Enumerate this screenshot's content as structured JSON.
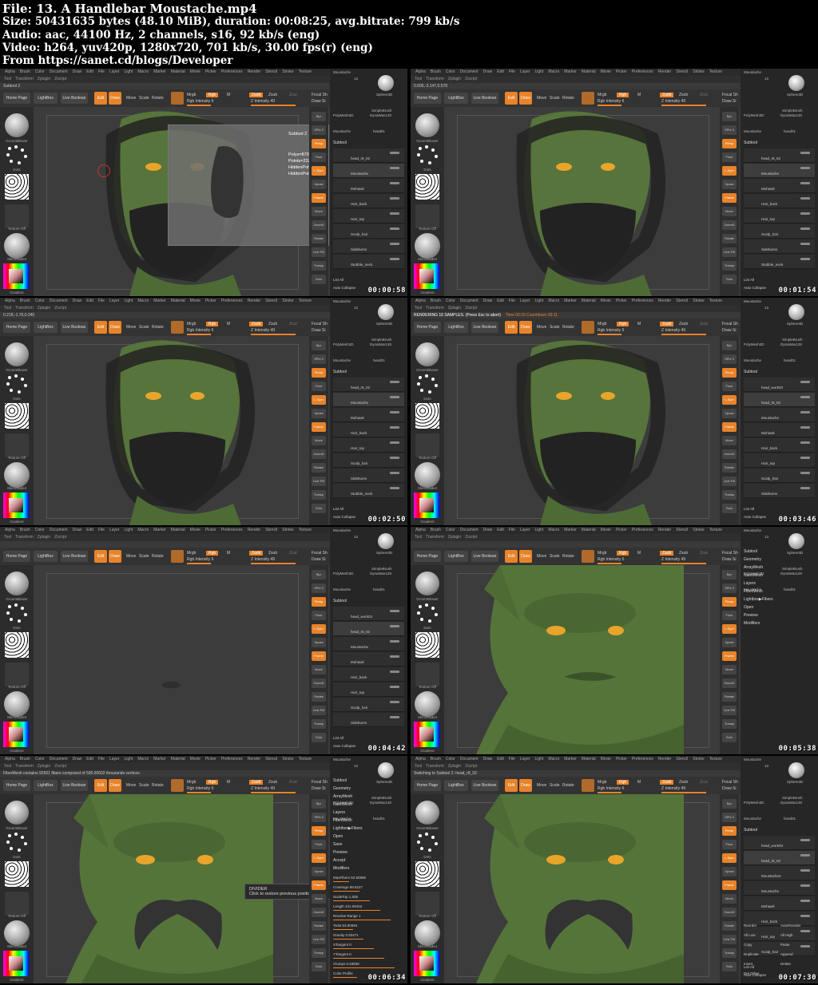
{
  "header": {
    "file": "File: 13. A Handlebar Moustache.mp4",
    "size": "Size: 50431635 bytes (48.10 MiB), duration: 00:08:25, avg.bitrate: 799 kb/s",
    "audio": "Audio: aac, 44100 Hz, 2 channels, s16, 92 kb/s (eng)",
    "video": "Video: h264, yuv420p, 1280x720, 701 kb/s, 30.00 fps(r) (eng)",
    "from": "From https://sanet.cd/blogs/Developer"
  },
  "menu": [
    "Alpha",
    "Brush",
    "Color",
    "Document",
    "Draw",
    "Edit",
    "File",
    "Layer",
    "Light",
    "Macro",
    "Marker",
    "Material",
    "Movie",
    "Picker",
    "Preferences",
    "Render",
    "Stencil",
    "Stroke",
    "Texture"
  ],
  "menu2": [
    "Tool",
    "Transform",
    "Zplugin",
    "Zscript"
  ],
  "toolbar": {
    "home": "Home Page",
    "lightbox": "LightBox",
    "live_boolean": "Live Boolean",
    "edit": "Edit",
    "draw": "Draw",
    "move": "Move",
    "scale": "Scale",
    "rotate": "Rotate",
    "mrgb": "Mrgb",
    "rgb": "Rgb",
    "m": "M",
    "zadd": "Zadd",
    "zsub": "Zsub",
    "zcut": "Zcut",
    "rgb_intensity": "Rgb Intensity 6",
    "z_intensity": "Z Intensity 49",
    "focal": "Focal Sh",
    "drawsize": "Draw Si"
  },
  "left": {
    "brush": "GroomBlower",
    "stroke": "Dots",
    "alpha": "~",
    "texture": "Texture Off",
    "material": "SkinShade4",
    "gradient": "Gradient"
  },
  "shelf": [
    "Bpr",
    "SPix 3",
    "Persp",
    "Floor",
    "L.Sym",
    "Xpose",
    "Frame",
    "Move",
    "ZoomD",
    "Rotate",
    "Line Fill",
    "Transp",
    "Solo"
  ],
  "toolpanel": {
    "thumb_top": "Moustache",
    "count": "13",
    "sphere": "Sphere3D",
    "simple": "SimpleBrush",
    "poly": "PolyMesh3D",
    "dyna": "DynaWax128",
    "moustache": "Moustache",
    "head": "head01",
    "subtool_title": "Subtool",
    "list_all": "List All",
    "auto_collapse": "Auto Collapse"
  },
  "frames": [
    {
      "timecode": "00:00:58",
      "status": "Subtool 2",
      "subtools": [
        "head_r8_02",
        "Moustache",
        "Mohawk",
        "Hair_back",
        "Hair_top",
        "Scalp_hair",
        "Sideburns",
        "Stubble_neck"
      ],
      "popup": {
        "title": "Subtool 2",
        "polys": "Polys=87030",
        "points": "Points=232080",
        "hpolys": "HiddenPolys=0",
        "hpoints": "HiddenPoints=0"
      }
    },
    {
      "timecode": "00:01:54",
      "status": "0.005,-3.147,0.578",
      "subtools": [
        "head_r8_02",
        "Moustache",
        "Mohawk",
        "Hair_back",
        "Hair_top",
        "Scalp_hair",
        "Sideburns",
        "Stubble_neck"
      ]
    },
    {
      "timecode": "00:02:50",
      "status": "0.218,-1.76,0.245",
      "subtools": [
        "head_r8_02",
        "Moustache",
        "Mohawk",
        "Hair_back",
        "Hair_top",
        "Scalp_hair",
        "Sideburns",
        "Stubble_neck"
      ]
    },
    {
      "timecode": "00:03:46",
      "render": "RENDERING 16 SAMPLES. (Press Esc to abort)",
      "render_time": "Time 00:15 Countdown 00:11",
      "subtools": [
        "head_work03",
        "head_r8_02",
        "Moustache",
        "Mohawk",
        "Hair_back",
        "Hair_top",
        "Scalp_hair",
        "Sideburns"
      ]
    },
    {
      "timecode": "00:04:42",
      "subtools": [
        "head_work03",
        "head_r8_02",
        "Moustache",
        "Mohawk",
        "Hair_back",
        "Hair_top",
        "Scalp_hair",
        "Sideburns"
      ]
    },
    {
      "timecode": "00:05:38",
      "subtools": [],
      "menu_items": [
        "Subtool",
        "Geometry",
        "ArrayMesh",
        "NanoMesh",
        "Layers",
        "FiberMesh",
        "Lightbox▶Fibers",
        "Open",
        "Preview",
        "Modifiers"
      ]
    },
    {
      "timecode": "00:06:34",
      "status": "FiberMesh contains 92501 fibers composed of 500.00602 thousands vertices.",
      "tooltip_title": "DIVIDER",
      "tooltip_text": "Click to restore previous position",
      "menu_items": [
        "Subtool",
        "Geometry",
        "ArrayMesh",
        "NanoMesh",
        "Layers",
        "FiberMesh",
        "Lightbox▶Fibers",
        "Open",
        "Save",
        "Preview",
        "Accept",
        "Modifiers"
      ],
      "fiber_values": [
        "MaxFibers 62.50995",
        "Coverage 88.6227",
        "ScaleTop 1.835",
        "Length 121.08422",
        "Revolve Range 1",
        "Twist 63.90694",
        "Gravity 0.83471",
        "XTangent 0",
        "YTangent 0",
        "Clumps 0.63836",
        "Color Profile"
      ]
    },
    {
      "timecode": "00:07:30",
      "status": "Switching to Subtool 2: head_r8_02",
      "subtools": [
        "head_work03",
        "head_r8_02",
        "Moustache2",
        "Moustache",
        "Mohawk",
        "Hair_back",
        "Hair_top",
        "Scalp_hair"
      ],
      "bottom_items": [
        "Reorder",
        "AutoReorder",
        "All Low",
        "All High",
        "Copy",
        "Paste",
        "Duplicate",
        "Append",
        "Insert",
        "Delete",
        "Del Other"
      ]
    }
  ],
  "colors": {
    "accent": "#e8832a",
    "skin": "#5b7a3e",
    "panel": "#262626",
    "viewport": "#3c3c3c"
  }
}
